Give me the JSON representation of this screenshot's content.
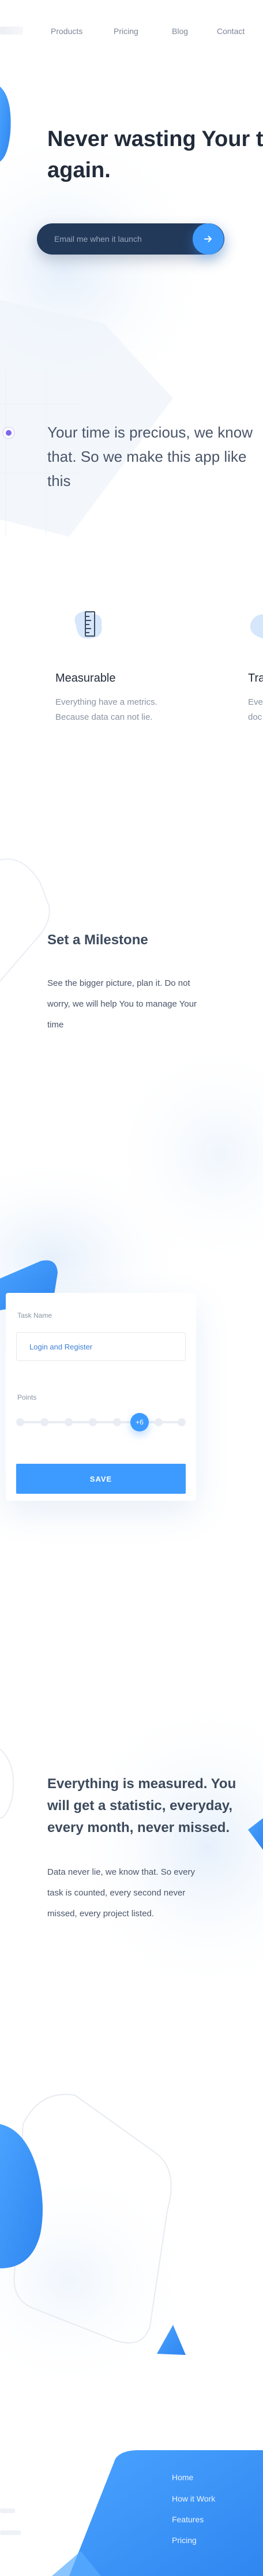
{
  "nav": {
    "items": [
      "Products",
      "Pricing",
      "Blog",
      "Contact"
    ]
  },
  "hero": {
    "title_line1": "Never wasting Your t",
    "title_line2": "again.",
    "email_placeholder": "Email me when it launch",
    "submit_icon": "arrow-right-icon"
  },
  "intro": {
    "text": "Your time is precious, we know that. So we make this app like this"
  },
  "features": [
    {
      "title": "Measurable",
      "desc": "Everything have a metrics. Because data can not lie.",
      "icon": "ruler-icon"
    },
    {
      "title": "Tra",
      "desc": "Eve\ndoc"
    }
  ],
  "milestone": {
    "title": "Set a Milestone",
    "desc": "See the bigger picture, plan it. Do not worry, we will help You to manage Your time"
  },
  "form": {
    "task_label": "Task Name",
    "task_value": "Login and Register",
    "points_label": "Points",
    "points_value": "+6",
    "points_fraction": 0.75,
    "save_label": "SAVE"
  },
  "measured": {
    "title": "Everything is measured. You will get a statistic, everyday, every month, never missed.",
    "desc": "Data never lie, we know that. So every task is counted, every second never missed, every project listed."
  },
  "footer": {
    "links": [
      "Home",
      "How it Work",
      "Features",
      "Pricing"
    ]
  },
  "colors": {
    "accent": "#3d9bff",
    "dark": "#22395a",
    "text": "#3d4a5c"
  }
}
